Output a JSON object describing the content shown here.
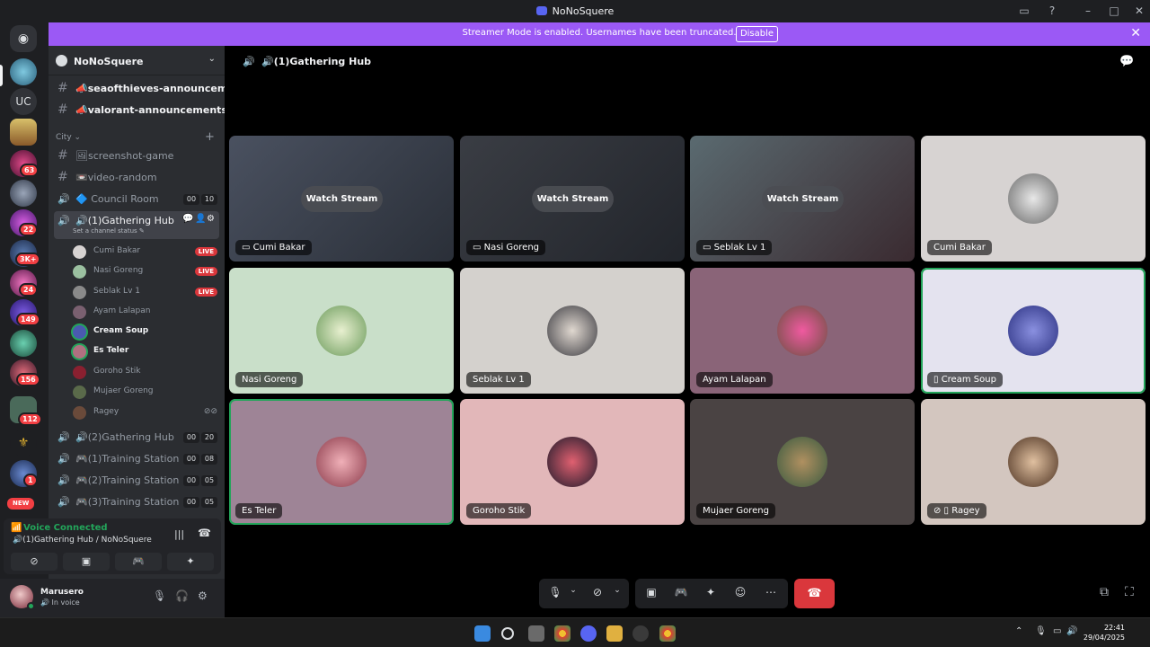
{
  "window": {
    "title": "NoNoSquere"
  },
  "banner": {
    "text": "Streamer Mode is enabled. Usernames have been truncated.",
    "button": "Disable"
  },
  "servers": [
    {
      "label": "UC"
    }
  ],
  "server_badges": [
    "63",
    "22",
    "3K+",
    "24",
    "149",
    "156",
    "112",
    "1"
  ],
  "new_badge": "NEW",
  "guild": {
    "name": "NoNoSquere"
  },
  "channels": {
    "announcements": [
      {
        "name": "📣seaofthieves-announceme…"
      },
      {
        "name": "📣valorant-announcements"
      }
    ],
    "category": "City",
    "list": [
      {
        "name": "🖼screenshot-game"
      },
      {
        "name": "📼video-random"
      },
      {
        "name": "🔷 Council Room",
        "count_a": "00",
        "count_b": "10"
      },
      {
        "name": "🔊(1)Gathering Hub",
        "status": "Set a channel status ✎"
      }
    ],
    "voice_users": [
      {
        "name": "Cumi Bakar",
        "live": "LIVE"
      },
      {
        "name": "Nasi Goreng",
        "live": "LIVE"
      },
      {
        "name": "Seblak Lv 1",
        "live": "LIVE"
      },
      {
        "name": "Ayam Lalapan"
      },
      {
        "name": "Cream Soup"
      },
      {
        "name": "Es Teler"
      },
      {
        "name": "Goroho Stik"
      },
      {
        "name": "Mujaer Goreng"
      },
      {
        "name": "Ragey"
      }
    ],
    "more": [
      {
        "name": "🔊(2)Gathering Hub",
        "count_a": "00",
        "count_b": "20"
      },
      {
        "name": "🎮(1)Training Station",
        "count_a": "00",
        "count_b": "08"
      },
      {
        "name": "🎮(2)Training Station",
        "count_a": "00",
        "count_b": "05"
      },
      {
        "name": "🎮(3)Training Station",
        "count_a": "00",
        "count_b": "05"
      }
    ]
  },
  "voice_panel": {
    "title": "Voice Connected",
    "subtitle": "🔊(1)Gathering Hub / NoNoSquere"
  },
  "account": {
    "name": "Marusero",
    "status": "🔊 In voice"
  },
  "stage": {
    "title": "🔊(1)Gathering Hub"
  },
  "tiles": [
    {
      "label": "Cumi Bakar",
      "watch": "Watch Stream",
      "bg": "#3a3f4a"
    },
    {
      "label": "Nasi Goreng",
      "watch": "Watch Stream",
      "bg": "#2e3138"
    },
    {
      "label": "Seblak Lv 1",
      "watch": "Watch Stream",
      "bg": "#3f4a4e"
    },
    {
      "label": "Cumi Bakar",
      "bg": "#d7d3d2"
    },
    {
      "label": "Nasi Goreng",
      "bg": "#c9dfc9"
    },
    {
      "label": "Seblak Lv 1",
      "bg": "#d4d1cd"
    },
    {
      "label": "Ayam Lalapan",
      "bg": "#8a6478"
    },
    {
      "label": "Cream Soup",
      "bg": "#e4e3ef"
    },
    {
      "label": "Es Teler",
      "bg": "#9e8496"
    },
    {
      "label": "Goroho Stik",
      "bg": "#e2b7b9"
    },
    {
      "label": "Mujaer Goreng",
      "bg": "#4a4343"
    },
    {
      "label": "Ragey",
      "bg": "#d3c6bf"
    }
  ],
  "clock": {
    "time": "22:41",
    "date": "29/04/2025"
  }
}
